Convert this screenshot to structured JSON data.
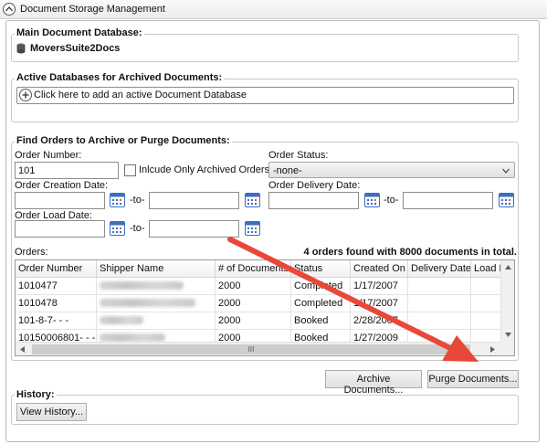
{
  "header": {
    "title": "Document Storage Management"
  },
  "main_db": {
    "legend": "Main Document Database:",
    "name": "MoversSuite2Docs"
  },
  "active_dbs": {
    "legend": "Active Databases for Archived Documents:",
    "add_label": "Click here to add an active Document Database"
  },
  "find": {
    "legend": "Find Orders to Archive or Purge Documents:",
    "order_number_label": "Order Number:",
    "order_number_value": "101",
    "include_archived_label": "Inlcude Only Archived Orders",
    "order_status_label": "Order Status:",
    "order_status_value": "-none-",
    "creation_label": "Order Creation Date:",
    "delivery_label": "Order Delivery Date:",
    "load_label": "Order Load Date:",
    "to_label": "-to-",
    "orders_label": "Orders:",
    "orders_found": "4 orders found with 8000 documents in total."
  },
  "grid": {
    "columns": [
      "Order Number",
      "Shipper Name",
      "# of Documents",
      "Status",
      "Created On",
      "Delivery Date",
      "Load D"
    ],
    "rows": [
      {
        "order": "1010477",
        "docs": "2000",
        "status": "Completed",
        "created": "1/17/2007"
      },
      {
        "order": "1010478",
        "docs": "2000",
        "status": "Completed",
        "created": "1/17/2007"
      },
      {
        "order": "101-8-7- - -",
        "docs": "2000",
        "status": "Booked",
        "created": "2/28/2007"
      },
      {
        "order": "10150006801- - -",
        "docs": "2000",
        "status": "Booked",
        "created": "1/27/2009"
      }
    ],
    "hscroll_thumb": "III"
  },
  "actions": {
    "archive": "Archive Documents...",
    "purge": "Purge Documents..."
  },
  "history": {
    "legend": "History:",
    "view": "View History..."
  },
  "colors": {
    "arrow": "#e8483a",
    "calendar": "#3a6fc4"
  }
}
